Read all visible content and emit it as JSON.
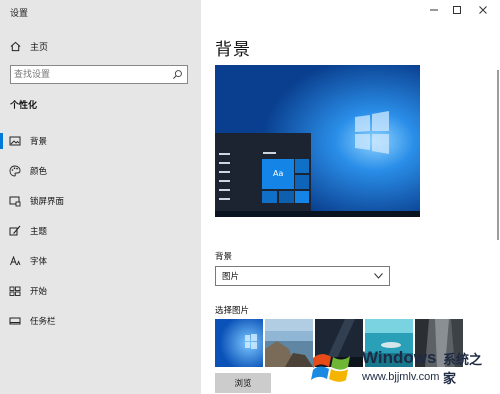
{
  "window": {
    "title": "设置"
  },
  "sidebar": {
    "home_label": "主页",
    "search": {
      "placeholder": "查找设置"
    },
    "section_title": "个性化",
    "items": [
      {
        "label": "背景",
        "icon": "picture-icon",
        "active": true
      },
      {
        "label": "颜色",
        "icon": "palette-icon",
        "active": false
      },
      {
        "label": "锁屏界面",
        "icon": "lock-screen-icon",
        "active": false
      },
      {
        "label": "主题",
        "icon": "brush-icon",
        "active": false
      },
      {
        "label": "字体",
        "icon": "font-icon",
        "active": false
      },
      {
        "label": "开始",
        "icon": "start-icon",
        "active": false
      },
      {
        "label": "任务栏",
        "icon": "taskbar-icon",
        "active": false
      }
    ]
  },
  "main": {
    "page_title": "背景",
    "preview": {
      "tile_text": "Aa"
    },
    "background_label": "背景",
    "background_value": "图片",
    "choose_picture_label": "选择图片",
    "thumbnails": [
      "windows-blue-light",
      "beach-rocks",
      "night-sky",
      "underwater-swimmer",
      "rock-cliff"
    ],
    "browse_label": "浏览"
  },
  "watermark": {
    "brand": "Windows",
    "brand_cn": "系统之家",
    "url": "www.bjjmlv.com"
  },
  "colors": {
    "accent": "#0078d7",
    "sidebar_bg": "#e6e6e6",
    "desktop_blue": "#0b63c8"
  }
}
